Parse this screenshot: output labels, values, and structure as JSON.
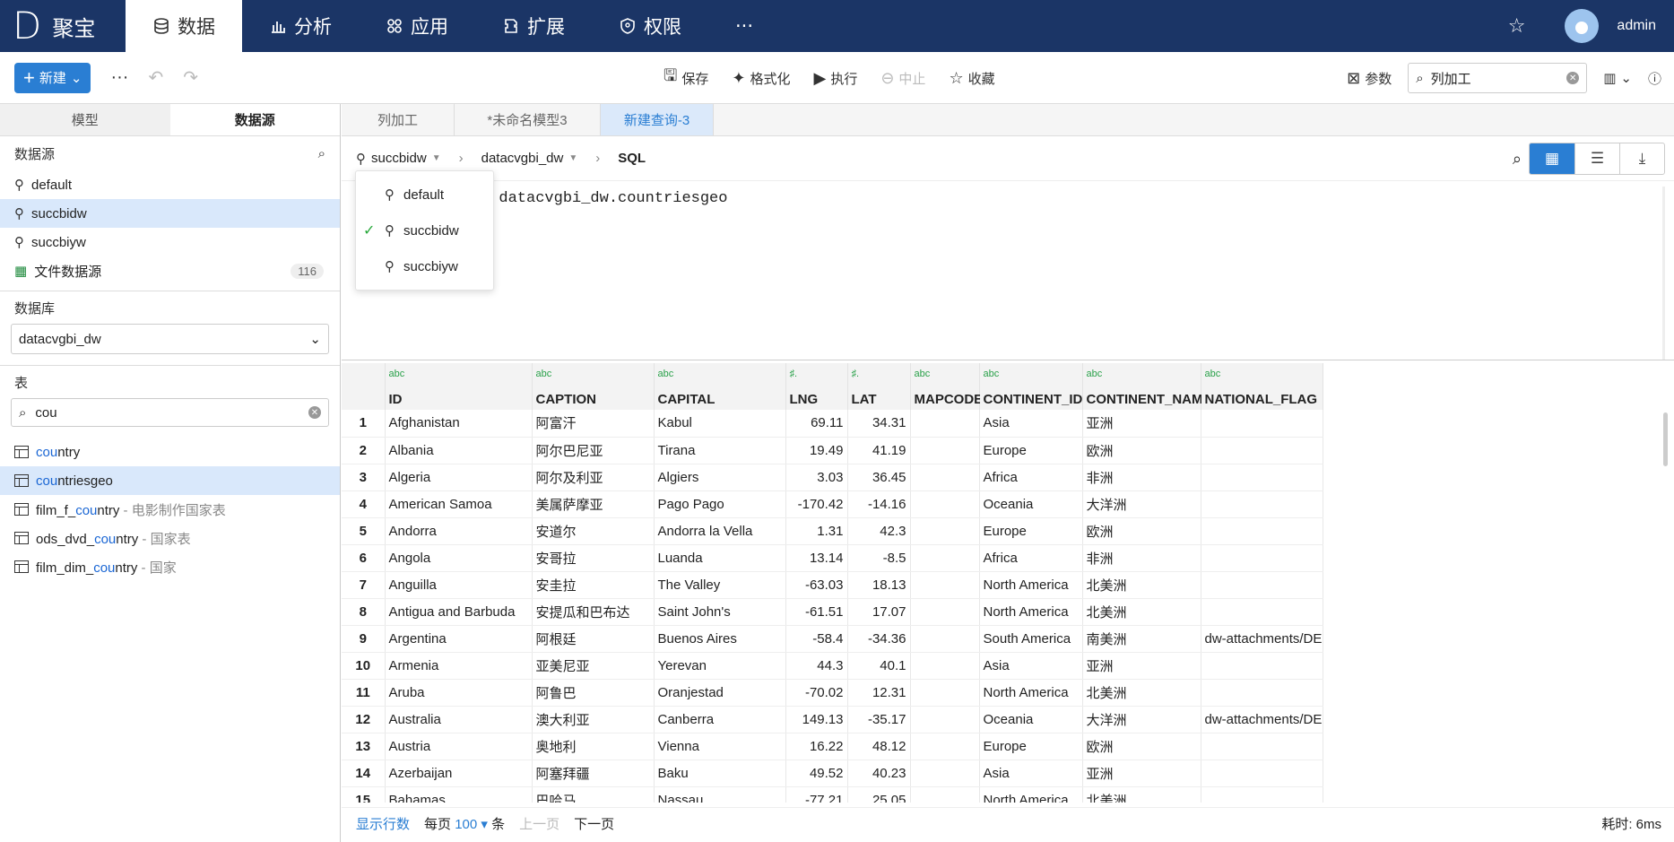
{
  "brand": {
    "logo": "D",
    "name": "聚宝"
  },
  "nav": {
    "items": [
      {
        "label": "数据",
        "icon": "database-icon",
        "active": true
      },
      {
        "label": "分析",
        "icon": "bar-chart-icon",
        "active": false
      },
      {
        "label": "应用",
        "icon": "apps-icon",
        "active": false
      },
      {
        "label": "扩展",
        "icon": "extension-icon",
        "active": false
      },
      {
        "label": "权限",
        "icon": "shield-icon",
        "active": false
      }
    ],
    "more": "···",
    "user": "admin"
  },
  "toolbar": {
    "new_label": "新建",
    "more": "···",
    "save": "保存",
    "format": "格式化",
    "execute": "执行",
    "stop": "中止",
    "favorite": "收藏",
    "params": "参数",
    "search_value": "列加工"
  },
  "left": {
    "tabs": [
      "模型",
      "数据源"
    ],
    "datasource_title": "数据源",
    "datasources": [
      {
        "name": "default",
        "selected": false
      },
      {
        "name": "succbidw",
        "selected": true
      },
      {
        "name": "succbiyw",
        "selected": false
      }
    ],
    "file_ds": {
      "name": "文件数据源",
      "count": "116"
    },
    "database_title": "数据库",
    "database_value": "datacvgbi_dw",
    "table_title": "表",
    "table_filter": "cou",
    "tables": [
      {
        "pre": "",
        "hl": "cou",
        "post": "ntry",
        "desc": "",
        "selected": false
      },
      {
        "pre": "",
        "hl": "cou",
        "post": "ntriesgeo",
        "desc": "",
        "selected": true
      },
      {
        "pre": "film_f_",
        "hl": "cou",
        "post": "ntry",
        "desc": " - 电影制作国家表",
        "selected": false
      },
      {
        "pre": "ods_dvd_",
        "hl": "cou",
        "post": "ntry",
        "desc": " - 国家表",
        "selected": false
      },
      {
        "pre": "film_dim_",
        "hl": "cou",
        "post": "ntry",
        "desc": " - 国家",
        "selected": false
      }
    ]
  },
  "editor": {
    "tabs": [
      {
        "label": "列加工",
        "active": false
      },
      {
        "label": "*未命名模型3",
        "active": false
      },
      {
        "label": "新建查询-3",
        "active": true
      }
    ],
    "crumb_ds": "succbidw",
    "crumb_db": "datacvgbi_dw",
    "crumb_sql": "SQL",
    "code_kw": "m",
    "code_rest": " datacvgbi_dw.countriesgeo",
    "dropdown": [
      {
        "name": "default",
        "checked": false
      },
      {
        "name": "succbidw",
        "checked": true
      },
      {
        "name": "succbiyw",
        "checked": false
      }
    ]
  },
  "grid": {
    "columns": [
      {
        "name": "ID",
        "type": "abc",
        "width": 164
      },
      {
        "name": "CAPTION",
        "type": "abc",
        "width": 136
      },
      {
        "name": "CAPITAL",
        "type": "abc",
        "width": 147
      },
      {
        "name": "LNG",
        "type": "♯.",
        "width": 69,
        "num": true
      },
      {
        "name": "LAT",
        "type": "♯.",
        "width": 70,
        "num": true
      },
      {
        "name": "MAPCODE",
        "type": "abc",
        "width": 77
      },
      {
        "name": "CONTINENT_ID",
        "type": "abc",
        "width": 115
      },
      {
        "name": "CONTINENT_NAME",
        "type": "abc",
        "width": 132
      },
      {
        "name": "NATIONAL_FLAG",
        "type": "abc",
        "width": 136
      }
    ],
    "rows": [
      [
        "1",
        "Afghanistan",
        "阿富汗",
        "Kabul",
        "69.11",
        "34.31",
        "",
        "Asia",
        "亚洲",
        ""
      ],
      [
        "2",
        "Albania",
        "阿尔巴尼亚",
        "Tirana",
        "19.49",
        "41.19",
        "",
        "Europe",
        "欧洲",
        ""
      ],
      [
        "3",
        "Algeria",
        "阿尔及利亚",
        "Algiers",
        "3.03",
        "36.45",
        "",
        "Africa",
        "非洲",
        ""
      ],
      [
        "4",
        "American Samoa",
        "美属萨摩亚",
        "Pago Pago",
        "-170.42",
        "-14.16",
        "",
        "Oceania",
        "大洋洲",
        ""
      ],
      [
        "5",
        "Andorra",
        "安道尔",
        "Andorra la Vella",
        "1.31",
        "42.3",
        "",
        "Europe",
        "欧洲",
        ""
      ],
      [
        "6",
        "Angola",
        "安哥拉",
        "Luanda",
        "13.14",
        "-8.5",
        "",
        "Africa",
        "非洲",
        ""
      ],
      [
        "7",
        "Anguilla",
        "安圭拉",
        "The Valley",
        "-63.03",
        "18.13",
        "",
        "North America",
        "北美洲",
        ""
      ],
      [
        "8",
        "Antigua and Barbuda",
        "安提瓜和巴布达",
        "Saint John's",
        "-61.51",
        "17.07",
        "",
        "North America",
        "北美洲",
        ""
      ],
      [
        "9",
        "Argentina",
        "阿根廷",
        "Buenos Aires",
        "-58.4",
        "-34.36",
        "",
        "South America",
        "南美洲",
        "dw-attachments/DEMO/"
      ],
      [
        "10",
        "Armenia",
        "亚美尼亚",
        "Yerevan",
        "44.3",
        "40.1",
        "",
        "Asia",
        "亚洲",
        ""
      ],
      [
        "11",
        "Aruba",
        "阿鲁巴",
        "Oranjestad",
        "-70.02",
        "12.31",
        "",
        "North America",
        "北美洲",
        ""
      ],
      [
        "12",
        "Australia",
        "澳大利亚",
        "Canberra",
        "149.13",
        "-35.17",
        "",
        "Oceania",
        "大洋洲",
        "dw-attachments/DEMO/"
      ],
      [
        "13",
        "Austria",
        "奥地利",
        "Vienna",
        "16.22",
        "48.12",
        "",
        "Europe",
        "欧洲",
        ""
      ],
      [
        "14",
        "Azerbaijan",
        "阿塞拜疆",
        "Baku",
        "49.52",
        "40.23",
        "",
        "Asia",
        "亚洲",
        ""
      ],
      [
        "15",
        "Bahamas",
        "巴哈马",
        "Nassau",
        "-77.21",
        "25.05",
        "",
        "North America",
        "北美洲",
        ""
      ]
    ]
  },
  "status": {
    "show_rows": "显示行数",
    "per_page": "每页",
    "page_size": "100",
    "unit": "条",
    "prev": "上一页",
    "next": "下一页",
    "elapsed": "耗时: 6ms"
  }
}
